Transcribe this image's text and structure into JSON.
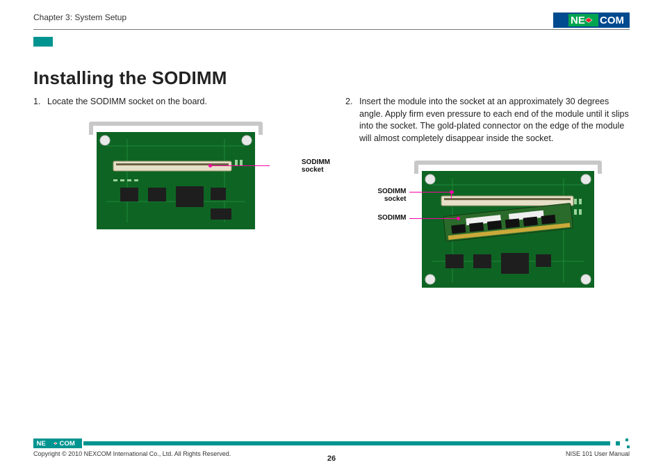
{
  "header": {
    "chapter": "Chapter 3: System Setup",
    "logo_text_left": "NE",
    "logo_text_right": "COM"
  },
  "title": "Installing the SODIMM",
  "steps": {
    "s1": {
      "num": "1.",
      "text": "Locate the SODIMM socket on the board."
    },
    "s2": {
      "num": "2.",
      "text": "Insert the module into the socket at an approximately 30 degrees angle. Apply firm even pressure to each end of the module until it slips into the socket. The gold-plated connector on the edge of the module will almost completely disappear inside the socket."
    }
  },
  "callouts": {
    "left_socket_l1": "SODIMM",
    "left_socket_l2": "socket",
    "right_socket_l1": "SODIMM",
    "right_socket_l2": "socket",
    "right_module": "SODIMM"
  },
  "footer": {
    "copyright": "Copyright © 2010 NEXCOM International Co., Ltd. All Rights Reserved.",
    "page": "26",
    "manual": "NISE 101 User Manual",
    "logo_text_left": "NE",
    "logo_text_right": "COM"
  }
}
